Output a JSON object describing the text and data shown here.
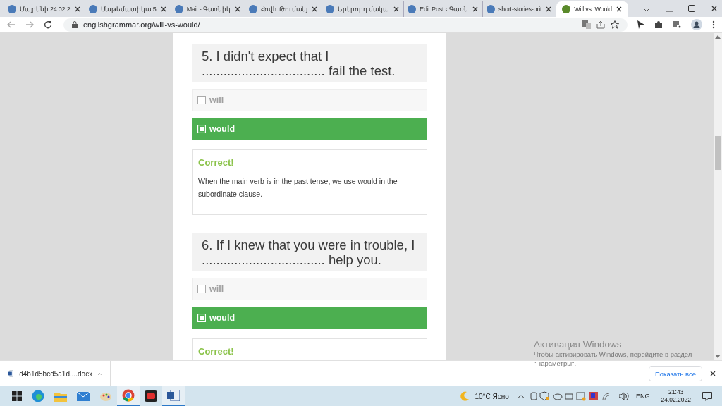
{
  "browser": {
    "tabs": [
      {
        "title": "Մայրենի 24.02.2",
        "selected": false
      },
      {
        "title": "Մաթեմատիկա 5",
        "selected": false
      },
      {
        "title": "Mail - Գառնիկ",
        "selected": false
      },
      {
        "title": "Հովh. Թումանյ",
        "selected": false
      },
      {
        "title": "Երկրորդ մակա",
        "selected": false
      },
      {
        "title": "Edit Post ‹ Գառն",
        "selected": false
      },
      {
        "title": "short-stories-brit",
        "selected": false
      },
      {
        "title": "Will vs. Would",
        "selected": true
      }
    ],
    "address": "englishgrammar.org/will-vs-would/"
  },
  "page": {
    "questions": [
      {
        "title": "5. I didn't expect that I .................................. fail the test.",
        "options": [
          {
            "label": "will",
            "selected": false
          },
          {
            "label": "would",
            "selected": true
          }
        ],
        "feedback": {
          "heading": "Correct!",
          "text": "When the main verb is in the past tense, we use would in the subordinate clause."
        }
      },
      {
        "title": "6. If I knew that you were in trouble, I .................................. help you.",
        "options": [
          {
            "label": "will",
            "selected": false
          },
          {
            "label": "would",
            "selected": true
          }
        ],
        "feedback": {
          "heading": "Correct!"
        }
      }
    ]
  },
  "activation": {
    "title": "Активация Windows",
    "text": "Чтобы активировать Windows, перейдите в раздел \"Параметры\"."
  },
  "downloads": {
    "file": "d4b1d5bcd5a1d....docx",
    "show_all": "Показать все"
  },
  "taskbar": {
    "weather": "10°C Ясно",
    "language": "ENG",
    "time": "21:43",
    "date": "24.02.2022"
  }
}
